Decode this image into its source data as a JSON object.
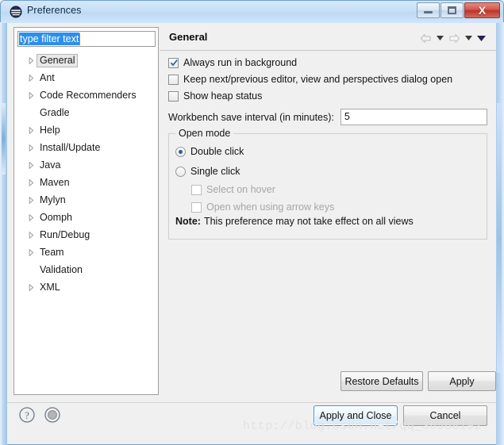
{
  "window": {
    "title": "Preferences",
    "icon": "eclipse-logo-icon",
    "buttons": {
      "minimize": "minimize-icon",
      "restore": "restore-icon",
      "close": "X"
    }
  },
  "sidebar": {
    "filter": {
      "value": "type filter text",
      "placeholder": "type filter text"
    },
    "items": [
      {
        "label": "General",
        "expandable": true,
        "selected": true
      },
      {
        "label": "Ant",
        "expandable": true,
        "selected": false
      },
      {
        "label": "Code Recommenders",
        "expandable": true,
        "selected": false
      },
      {
        "label": "Gradle",
        "expandable": false,
        "selected": false
      },
      {
        "label": "Help",
        "expandable": true,
        "selected": false
      },
      {
        "label": "Install/Update",
        "expandable": true,
        "selected": false
      },
      {
        "label": "Java",
        "expandable": true,
        "selected": false
      },
      {
        "label": "Maven",
        "expandable": true,
        "selected": false
      },
      {
        "label": "Mylyn",
        "expandable": true,
        "selected": false
      },
      {
        "label": "Oomph",
        "expandable": true,
        "selected": false
      },
      {
        "label": "Run/Debug",
        "expandable": true,
        "selected": false
      },
      {
        "label": "Team",
        "expandable": true,
        "selected": false
      },
      {
        "label": "Validation",
        "expandable": false,
        "selected": false
      },
      {
        "label": "XML",
        "expandable": true,
        "selected": false
      }
    ]
  },
  "panel": {
    "title": "General",
    "nav": {
      "back": "back-arrow-icon",
      "back_menu": "back-dropdown-icon",
      "forward": "forward-arrow-icon",
      "forward_menu": "forward-dropdown-icon",
      "view_menu": "view-menu-icon"
    },
    "checkboxes": [
      {
        "label": "Always run in background",
        "checked": true,
        "disabled": false
      },
      {
        "label": "Keep next/previous editor, view and perspectives dialog open",
        "checked": false,
        "disabled": false
      },
      {
        "label": "Show heap status",
        "checked": false,
        "disabled": false
      }
    ],
    "save_interval": {
      "label": "Workbench save interval (in minutes):",
      "value": "5"
    },
    "open_mode": {
      "legend": "Open mode",
      "radios": [
        {
          "label": "Double click",
          "selected": true
        },
        {
          "label": "Single click",
          "selected": false
        }
      ],
      "sub_checkboxes": [
        {
          "label": "Select on hover",
          "checked": false,
          "disabled": true
        },
        {
          "label": "Open when using arrow keys",
          "checked": false,
          "disabled": true
        }
      ],
      "note_prefix": "Note:",
      "note_text": "This preference may not take effect on all views"
    },
    "restore_defaults_label": "Restore Defaults",
    "apply_label": "Apply"
  },
  "footer": {
    "help_icon": "help-question-icon",
    "secondary_icon": "grayed-circle-icon",
    "apply_and_close_label": "Apply and Close",
    "cancel_label": "Cancel"
  },
  "watermark": "http://blog.csdn.net/qq_36568192",
  "colors": {
    "selection_blue": "#2c8fec",
    "accent_blue": "#3c99d4",
    "close_red": "#b8352b",
    "panel_bg": "#f0f0f0"
  }
}
